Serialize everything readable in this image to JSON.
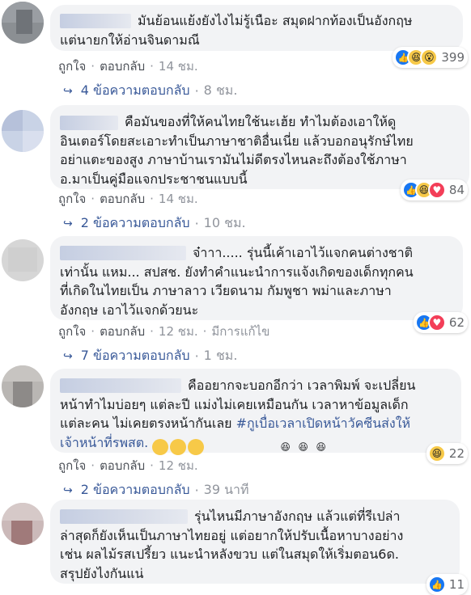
{
  "labels": {
    "like": "ถูกใจ",
    "reply": "ตอบกลับ",
    "edited": "มีการแก้ไข"
  },
  "comments": [
    {
      "text": "มันย้อนแย้งยังไงไม่รู้เนือะ สมุดฝากท้องเป็นอังกฤษ\nแต่นายกให้อ่านจินดามณี",
      "time": "14 ชม.",
      "reactions": [
        "like",
        "haha",
        "wow"
      ],
      "reaction_count": "399",
      "replies": "4 ข้อความตอบกลับ",
      "replies_time": "8 ชม."
    },
    {
      "text": "คือมันของที่ให้คนไทยใช้นะเฮ้ย ทำไมต้องเอาให้ดู\nอินเตอร์โดยสะเอาะทำเป็นภาษาชาติอื่นเนี่ย แล้วบอกอนุรักษ์ไทย\nอย่าแตะของสูง ภาษาบ้านเรามันไม่ดีตรงไหนละถึงต้องใช้ภาษา\nอ.มาเป็นคู่มือแจกประชาชนแบบนี้",
      "time": "14 ชม.",
      "reactions": [
        "like",
        "haha",
        "love"
      ],
      "reaction_count": "84",
      "replies": "2 ข้อความตอบกลับ",
      "replies_time": "10 ชม."
    },
    {
      "text": "จ๋าาา..... รุ่นนี้เค้าเอาไว้แจกคนต่างชาติ\nเท่านั้น แหม... สปสช. ยังทำคำแนะนำการแจ้งเกิดของเด็กทุกคน\nที่เกิดในไทยเป็น ภาษาลาว เวียดนาม กัมพูชา พม่าและภาษา\nอังกฤษ เอาไว้แจกด้วยนะ",
      "time": "12 ชม.",
      "edited": true,
      "reactions": [
        "like",
        "love"
      ],
      "reaction_count": "62",
      "replies": "7 ข้อความตอบกลับ",
      "replies_time": "1 ชม."
    },
    {
      "text_before": "คืออยากจะบอกอีกว่า เวลาพิมพ์ จะเปลี่ยน\nหน้าทำไมบ่อยๆ แต่ละปี แม่งไม่เคยเหมือนกัน เวลาหาข้อมูลเด็ก\nแต่ละคน ไม่เคยตรงหน้ากันเลย ",
      "hashtag": "#กูเบื่อเวลาเปิดหน้าวัคซีนส่งให้\nเจ้าหน้าที่รพสต.",
      "time": "12 ชม.",
      "reactions": [
        "haha"
      ],
      "reaction_count": "22",
      "replies": "2 ข้อความตอบกลับ",
      "replies_time": "39 นาที"
    },
    {
      "text": "รุ่นไหนมีภาษาอังกฤษ แล้วแต่ที่รีเปล่า\nล่าสุดก็ยังเห็นเป็นภาษาไทยอยู่ แต่อยากให้ปรับเนื้อหาบางอย่าง\nเช่น ผลไม้รสเปรี้ยว แนะนำหลังขวบ แต่ในสมุดให้เริ่มตอน6ด.\nสรุปยังไงกันแน่",
      "reactions": [
        "like"
      ],
      "reaction_count": "11"
    }
  ],
  "colors": {
    "bubble": "#f2f3f5",
    "link": "#385898",
    "meta": "#90949c"
  }
}
